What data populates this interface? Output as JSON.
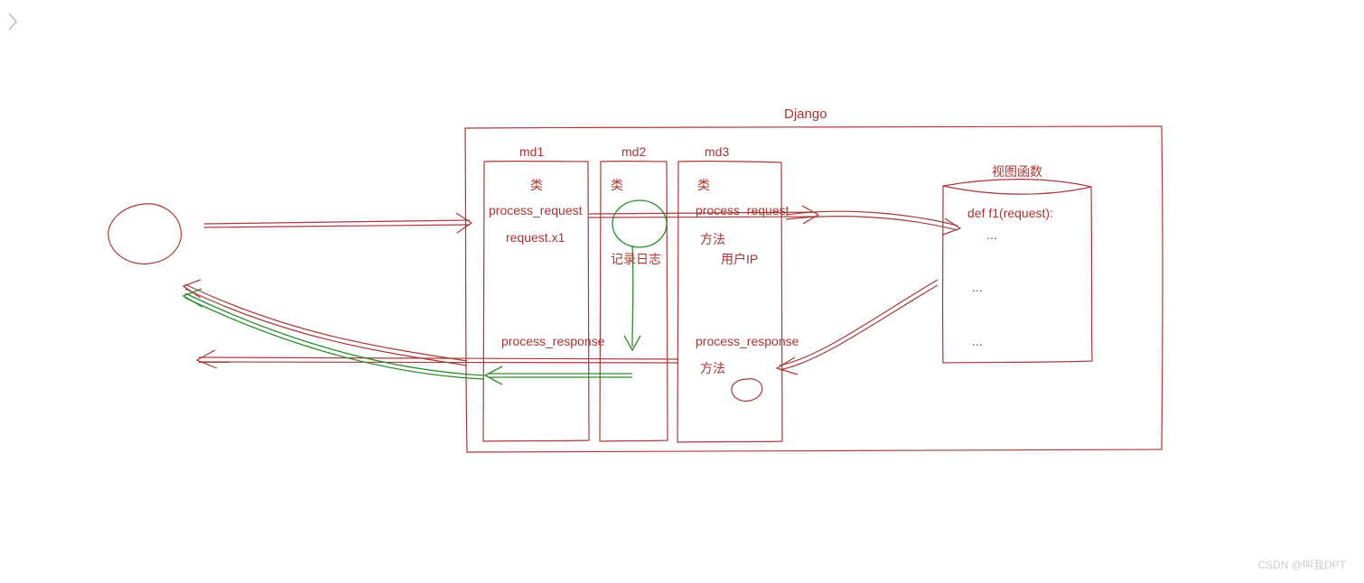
{
  "container_title": "Django",
  "middleware": {
    "md1": {
      "title": "md1",
      "class_label": "类",
      "process_request": "process_request",
      "request_attr": "request.x1",
      "process_response": "process_response"
    },
    "md2": {
      "title": "md2",
      "class_label": "类",
      "log_label": "记录日志"
    },
    "md3": {
      "title": "md3",
      "class_label": "类",
      "process_request": "process_request",
      "method_label": "方法",
      "user_ip": "用户IP",
      "process_response": "process_response",
      "method_label2": "方法"
    }
  },
  "view": {
    "title": "视图函数",
    "body_line1": "def f1(request):",
    "body_line2": "...",
    "body_line3": "...",
    "body_line4": "..."
  },
  "watermark": "CSDN @叫我DPT"
}
